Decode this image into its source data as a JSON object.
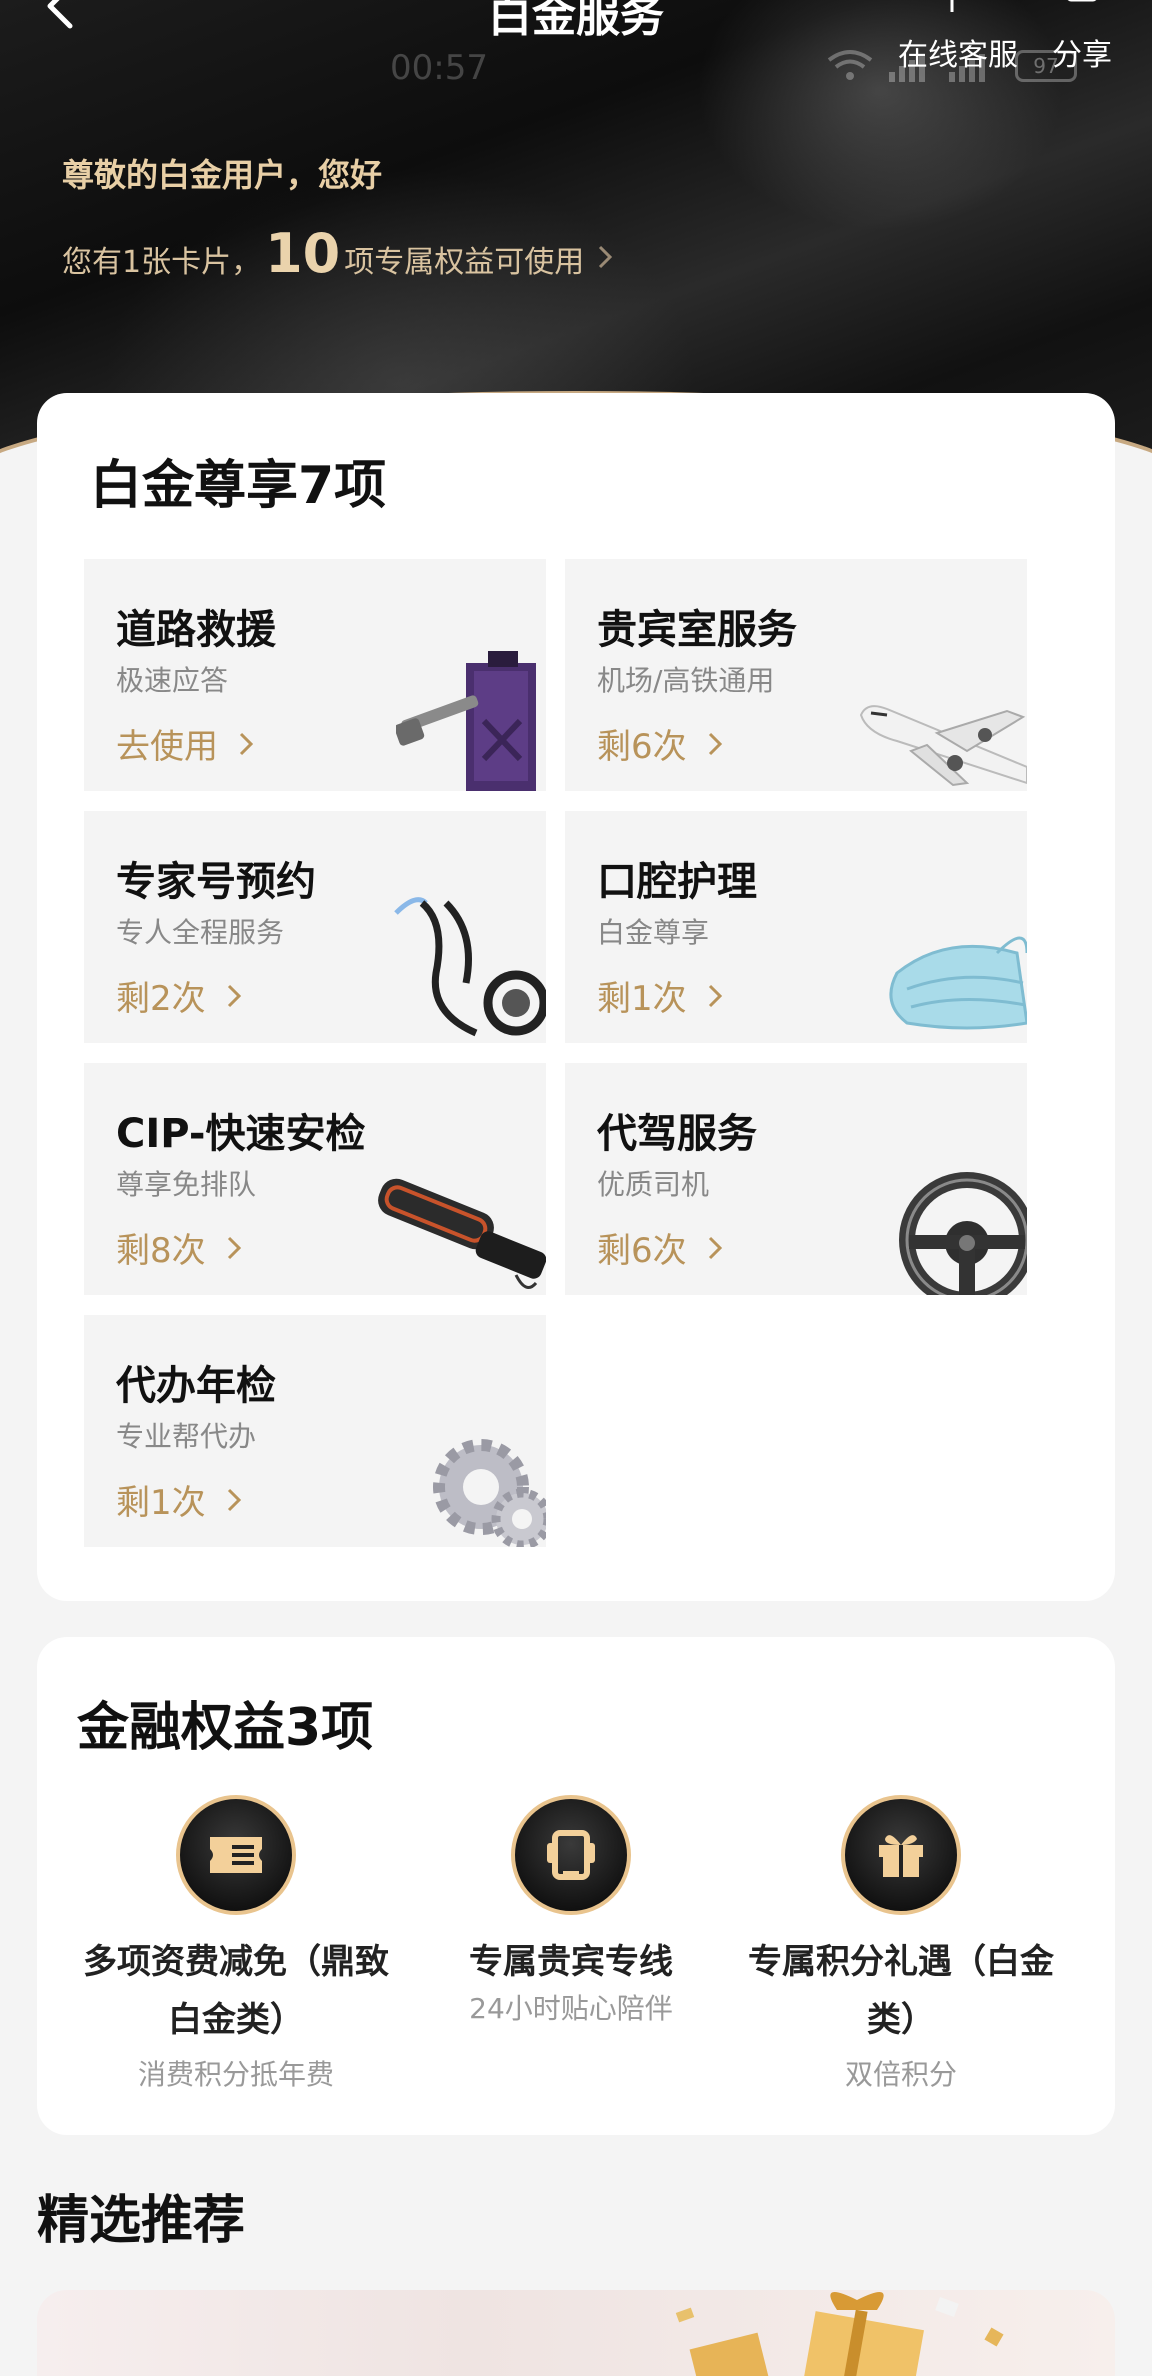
{
  "header": {
    "title": "白金服务",
    "status_time": "00:57",
    "battery": "97",
    "actions": [
      {
        "label": "在线客服",
        "icon": "headset-icon"
      },
      {
        "label": "分享",
        "icon": "share-icon"
      }
    ]
  },
  "hero": {
    "greeting": "尊敬的白金用户，您好",
    "summary_prefix": "您有1张卡片，",
    "summary_count": "10",
    "summary_suffix": "项专属权益可使用"
  },
  "vip_section": {
    "title": "白金尊享7项",
    "tiles": [
      {
        "title": "道路救援",
        "subtitle": "极速应答",
        "action": "去使用",
        "icon": "fuel-can-hammer-icon"
      },
      {
        "title": "贵宾室服务",
        "subtitle": "机场/高铁通用",
        "action": "剩6次",
        "icon": "airplane-icon"
      },
      {
        "title": "专家号预约",
        "subtitle": "专人全程服务",
        "action": "剩2次",
        "icon": "stethoscope-icon"
      },
      {
        "title": "口腔护理",
        "subtitle": "白金尊享",
        "action": "剩1次",
        "icon": "mask-icon"
      },
      {
        "title": "CIP-快速安检",
        "subtitle": "尊享免排队",
        "action": "剩8次",
        "icon": "metal-detector-icon"
      },
      {
        "title": "代驾服务",
        "subtitle": "优质司机",
        "action": "剩6次",
        "icon": "steering-wheel-icon"
      },
      {
        "title": "代办年检",
        "subtitle": "专业帮代办",
        "action": "剩1次",
        "icon": "gears-icon"
      }
    ]
  },
  "finance_section": {
    "title": "金融权益3项",
    "items": [
      {
        "name_line1": "多项资费减免（鼎致",
        "name_line2": "白金类）",
        "subtitle": "消费积分抵年费",
        "icon": "ticket-icon"
      },
      {
        "name_line1": "专属贵宾专线",
        "name_line2": "",
        "subtitle": "24小时贴心陪伴",
        "icon": "phone-icon"
      },
      {
        "name_line1": "专属积分礼遇（白金",
        "name_line2": "类）",
        "subtitle": "双倍积分",
        "icon": "gift-icon"
      }
    ]
  },
  "recommend": {
    "title": "精选推荐"
  },
  "colors": {
    "gold": "#b8935a",
    "hero_text": "#e8cfa6",
    "tile_bg": "#f4f4f4"
  }
}
